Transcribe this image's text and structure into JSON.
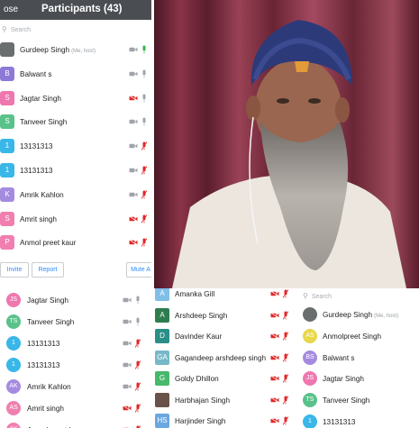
{
  "colors": {
    "header_bg": "#4a4d52",
    "link_blue": "#2d8cff",
    "muted_red": "#e02828",
    "icon_gray": "#a0a4aa"
  },
  "main_panel": {
    "close_label": "ose",
    "title": "Participants (43)",
    "search_placeholder": "Search",
    "participants": [
      {
        "name": "Gurdeep Singh",
        "tag": "(Me, host)",
        "avatar": "",
        "color": "#6b6e6f",
        "photo": true,
        "cam": "gray",
        "mic": "green"
      },
      {
        "name": "Balwant s",
        "avatar": "B",
        "color": "#8c79d6",
        "cam": "gray",
        "mic": "gray"
      },
      {
        "name": "Jagtar Singh",
        "avatar": "S",
        "color": "#ef77b0",
        "cam": "red",
        "mic": "gray"
      },
      {
        "name": "Tanveer Singh",
        "avatar": "S",
        "color": "#58c28a",
        "cam": "gray",
        "mic": "gray"
      },
      {
        "name": "13131313",
        "avatar": "1",
        "color": "#39b7e8",
        "cam": "gray",
        "mic": "red"
      },
      {
        "name": "13131313",
        "avatar": "1",
        "color": "#39b7e8",
        "cam": "gray",
        "mic": "red"
      },
      {
        "name": "Amrik Kahlon",
        "avatar": "K",
        "color": "#a58be0",
        "cam": "gray",
        "mic": "red"
      },
      {
        "name": "Amrit singh",
        "avatar": "S",
        "color": "#f07fb0",
        "cam": "red",
        "mic": "red"
      },
      {
        "name": "Anmol preet kaur",
        "avatar": "P",
        "color": "#f07fb0",
        "cam": "red",
        "mic": "red"
      }
    ],
    "actions": {
      "invite": "Invite",
      "report": "Report",
      "mute_all": "Mute A"
    }
  },
  "bottom_left": {
    "participants": [
      {
        "name": "Jagtar Singh",
        "avatar": "JS",
        "color": "#ef77b0",
        "cam": "gray",
        "mic": "gray"
      },
      {
        "name": "Tanveer Singh",
        "avatar": "TS",
        "color": "#58c28a",
        "cam": "gray",
        "mic": "gray"
      },
      {
        "name": "13131313",
        "avatar": "1",
        "color": "#39b7e8",
        "cam": "gray",
        "mic": "red"
      },
      {
        "name": "13131313",
        "avatar": "1",
        "color": "#39b7e8",
        "cam": "gray",
        "mic": "red"
      },
      {
        "name": "Amrik Kahlon",
        "avatar": "AK",
        "color": "#a58be0",
        "cam": "gray",
        "mic": "red"
      },
      {
        "name": "Amrit singh",
        "avatar": "AS",
        "color": "#f07fb0",
        "cam": "red",
        "mic": "red"
      },
      {
        "name": "Anmol preet kaur",
        "avatar": "AK",
        "color": "#f07fb0",
        "cam": "red",
        "mic": "red"
      }
    ]
  },
  "bottom_middle": {
    "participants": [
      {
        "name": "Amanka Gill",
        "avatar": "A",
        "color": "#7fbfe8",
        "cam": "red",
        "mic": "red"
      },
      {
        "name": "Arshdeep Singh",
        "avatar": "A",
        "color": "#2e7d4f",
        "cam": "red",
        "mic": "red"
      },
      {
        "name": "Davinder Kaur",
        "avatar": "D",
        "color": "#2a8f87",
        "cam": "red",
        "mic": "red"
      },
      {
        "name": "Gagandeep arshdeep singh",
        "avatar": "GA",
        "color": "#78b8c8",
        "cam": "red",
        "mic": "red"
      },
      {
        "name": "Goldy Dhillon",
        "avatar": "G",
        "color": "#48b86a",
        "cam": "red",
        "mic": "red"
      },
      {
        "name": "Harbhajan Singh",
        "avatar": "",
        "color": "#6a5248",
        "photo": true,
        "cam": "red",
        "mic": "red"
      },
      {
        "name": "Harjinder Singh",
        "avatar": "HS",
        "color": "#6aa8e0",
        "cam": "red",
        "mic": "red"
      }
    ]
  },
  "bottom_right": {
    "search_placeholder": "Search",
    "participants": [
      {
        "name": "Gurdeep Singh",
        "tag": "(Me, host)",
        "avatar": "",
        "color": "#6b6e6f",
        "photo": true
      },
      {
        "name": "Anmolpreet Singh",
        "avatar": "AS",
        "color": "#e8d84a"
      },
      {
        "name": "Balwant s",
        "avatar": "BS",
        "color": "#a58be0"
      },
      {
        "name": "Jagtar Singh",
        "avatar": "JS",
        "color": "#ef77b0"
      },
      {
        "name": "Tanveer Singh",
        "avatar": "TS",
        "color": "#58c28a"
      },
      {
        "name": "13131313",
        "avatar": "1",
        "color": "#39b7e8"
      }
    ]
  }
}
